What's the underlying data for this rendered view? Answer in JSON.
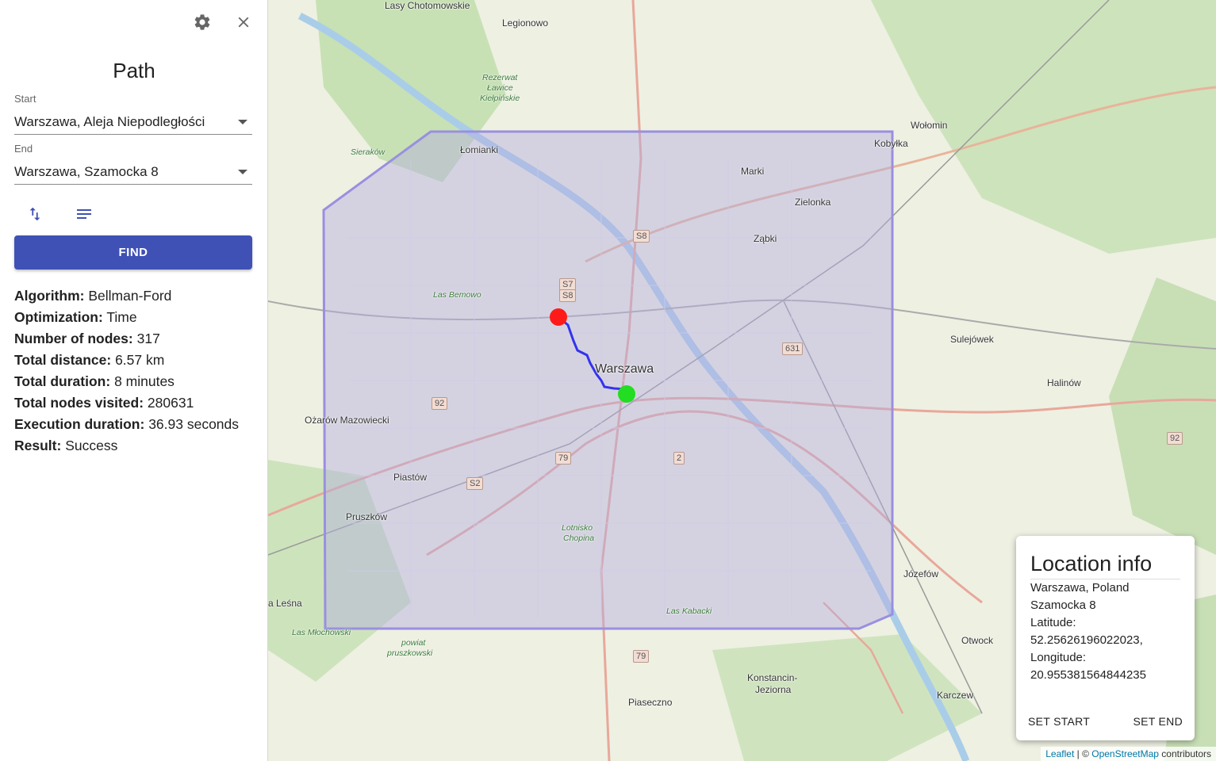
{
  "sidebar": {
    "title": "Path",
    "start": {
      "label": "Start",
      "value": "Warszawa,  Aleja Niepodległości"
    },
    "end": {
      "label": "End",
      "value": "Warszawa,  Szamocka 8"
    },
    "find_label": "FIND",
    "stats": [
      {
        "key": "Algorithm:",
        "value": "Bellman-Ford"
      },
      {
        "key": "Optimization:",
        "value": "Time"
      },
      {
        "key": "Number of nodes:",
        "value": "317"
      },
      {
        "key": "Total distance:",
        "value": "6.57 km"
      },
      {
        "key": "Total duration:",
        "value": "8 minutes"
      },
      {
        "key": "Total nodes visited:",
        "value": "280631"
      },
      {
        "key": "Execution duration:",
        "value": "36.93 seconds"
      },
      {
        "key": "Result:",
        "value": "Success"
      }
    ]
  },
  "map": {
    "labels": {
      "warszawa": "Warszawa",
      "legionowo": "Legionowo",
      "lomianki": "Łomianki",
      "marki": "Marki",
      "zielonka": "Zielonka",
      "zabki": "Ząbki",
      "kobylka": "Kobyłka",
      "wolomin": "Wołomin",
      "sulejowek": "Sulejówek",
      "halinow": "Halinów",
      "ozarow": "Ożarów Mazowiecki",
      "piastow": "Piastów",
      "pruszkow": "Pruszków",
      "jozefow": "Józefów",
      "otwock": "Otwock",
      "karczew": "Karczew",
      "konstancin": "Konstancin-",
      "jeziorna": "Jeziorna",
      "piaseczno": "Piaseczno",
      "lesna": "a Leśna",
      "lasy_chotomowskie": "Lasy Chotomowskie",
      "las_bemowo": "Las Bemowo",
      "las_kabacki": "Las Kabacki",
      "lotnisko": "Lotnisko",
      "chopina": "Chopina",
      "sierakow": "Sieraków",
      "rezerwat": "Rezerwat",
      "lawice": "Ławice",
      "kielpinskie": "Kiełpińskie",
      "las_mlochowski": "Las Młochowski",
      "powiat": "powiat",
      "pruszkowski": "pruszkowski"
    },
    "shields": [
      "S8",
      "S7",
      "S8",
      "631",
      "92",
      "79",
      "2",
      "S2",
      "92",
      "79"
    ],
    "route_color": "#3333ee",
    "start_marker_color": "#ff1a1a",
    "end_marker_color": "#22dd22",
    "bbox_color": "#9a8fe0"
  },
  "location_info": {
    "title": "Location info",
    "lines": [
      "Warszawa, Poland",
      "Szamocka 8",
      "Latitude:",
      "52.25626196022023,",
      "Longitude:",
      "20.955381564844235"
    ],
    "set_start": "SET START",
    "set_end": "SET END"
  },
  "attribution": {
    "leaflet": "Leaflet",
    "sep": " | © ",
    "osm": "OpenStreetMap",
    "contributors": " contributors"
  }
}
